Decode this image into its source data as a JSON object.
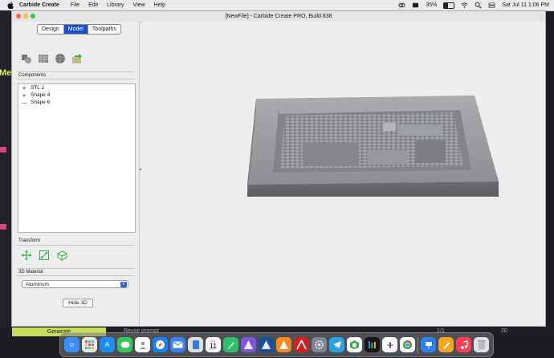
{
  "menubar": {
    "app_name": "Carbide Create",
    "items": [
      "File",
      "Edit",
      "Library",
      "View",
      "Help"
    ],
    "battery": "35%",
    "clock": "Sat Jul 11  1:06 PM"
  },
  "window": {
    "title": "[NewFile] - Carbide Create PRO, Build 838"
  },
  "tabs": [
    "Design",
    "Model",
    "Toolpaths"
  ],
  "active_tab": "Model",
  "sections": {
    "components": "Components",
    "transform": "Transform",
    "material": "3D Material"
  },
  "components": [
    {
      "label": "STL 2",
      "glyph": "+"
    },
    {
      "label": "Shape 4",
      "glyph": "+"
    },
    {
      "label": "Shape 6",
      "glyph": "—"
    }
  ],
  "material": {
    "selected": "Aluminum"
  },
  "hide_button": "Hide 3D",
  "background_app": {
    "fragment": "Mes",
    "generate": "Generate",
    "reuse": "Reuse prompt",
    "page": "1/1",
    "count": "20"
  },
  "dock": {
    "calendar_month": "JUL",
    "calendar_day": "11"
  },
  "colors": {
    "tab_active": "#1a4ec5",
    "viewport_bg": "#ededed",
    "model": "#8a8c90",
    "generate": "#c6dd5a"
  }
}
